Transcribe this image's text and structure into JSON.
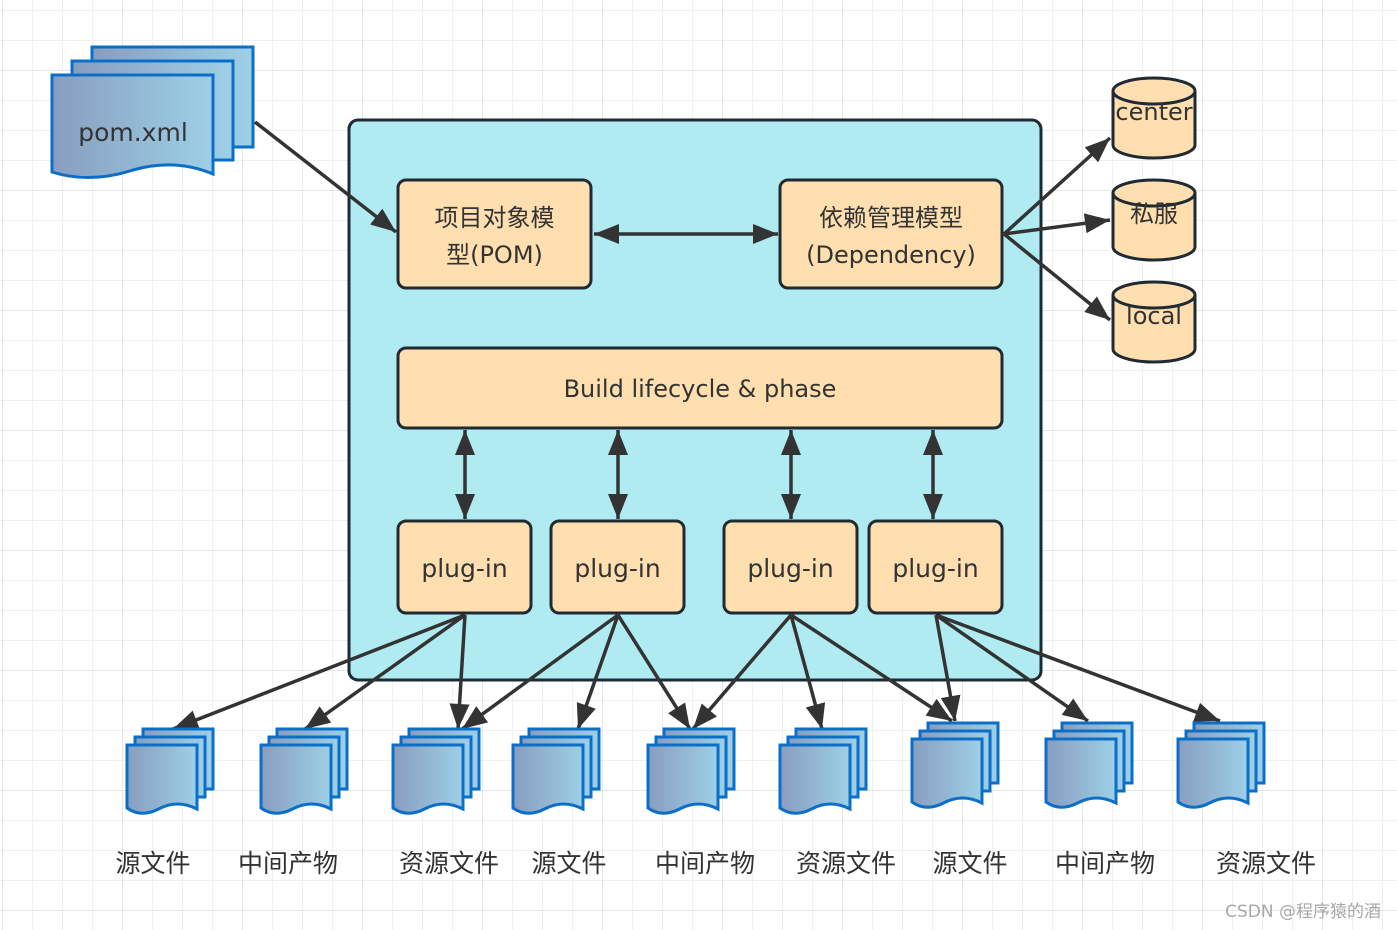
{
  "diagram": {
    "source": {
      "label": "pom.xml",
      "icon": "document-stack-icon"
    },
    "container": {
      "pom_model": {
        "line1": "项目对象模",
        "line2": "型(POM)"
      },
      "dependency_model": {
        "line1": "依赖管理模型",
        "line2": "(Dependency)"
      },
      "lifecycle": {
        "label": "Build lifecycle & phase"
      },
      "plugins": [
        {
          "label": "plug-in"
        },
        {
          "label": "plug-in"
        },
        {
          "label": "plug-in"
        },
        {
          "label": "plug-in"
        }
      ]
    },
    "repositories": [
      {
        "label": "center",
        "icon": "database-icon"
      },
      {
        "label": "私服",
        "icon": "database-icon"
      },
      {
        "label": "local",
        "icon": "database-icon"
      }
    ],
    "outputs": [
      {
        "label": "源文件"
      },
      {
        "label": "中间产物"
      },
      {
        "label": "资源文件"
      },
      {
        "label": "源文件"
      },
      {
        "label": "中间产物"
      },
      {
        "label": "资源文件"
      },
      {
        "label": "源文件"
      },
      {
        "label": "中间产物"
      },
      {
        "label": "资源文件"
      }
    ],
    "edges": [
      {
        "from": "pom.xml",
        "to": "项目对象模型(POM)"
      },
      {
        "from": "项目对象模型(POM)",
        "to": "依赖管理模型(Dependency)",
        "bidirectional": true
      },
      {
        "from": "依赖管理模型(Dependency)",
        "to": "center"
      },
      {
        "from": "依赖管理模型(Dependency)",
        "to": "私服"
      },
      {
        "from": "依赖管理模型(Dependency)",
        "to": "local"
      },
      {
        "from": "Build lifecycle & phase",
        "to": "plug-in 1",
        "bidirectional": true
      },
      {
        "from": "Build lifecycle & phase",
        "to": "plug-in 2",
        "bidirectional": true
      },
      {
        "from": "Build lifecycle & phase",
        "to": "plug-in 3",
        "bidirectional": true
      },
      {
        "from": "Build lifecycle & phase",
        "to": "plug-in 4",
        "bidirectional": true
      },
      {
        "from": "plug-in 1",
        "to": "output 1"
      },
      {
        "from": "plug-in 1",
        "to": "output 2"
      },
      {
        "from": "plug-in 1",
        "to": "output 3"
      },
      {
        "from": "plug-in 2",
        "to": "output 3"
      },
      {
        "from": "plug-in 2",
        "to": "output 4"
      },
      {
        "from": "plug-in 2",
        "to": "output 5"
      },
      {
        "from": "plug-in 3",
        "to": "output 5"
      },
      {
        "from": "plug-in 3",
        "to": "output 6"
      },
      {
        "from": "plug-in 3",
        "to": "output 7"
      },
      {
        "from": "plug-in 4",
        "to": "output 7"
      },
      {
        "from": "plug-in 4",
        "to": "output 8"
      },
      {
        "from": "plug-in 4",
        "to": "output 9"
      }
    ]
  },
  "colors": {
    "container_fill": "#b0ebf2",
    "node_fill": "#ffdfb0",
    "stroke": "#1f2a33",
    "arrow": "#333333",
    "doc_stroke": "#0b6fc9",
    "doc_gradient_start": "#8aa0c0",
    "doc_gradient_end": "#9ccfe6"
  },
  "watermark": "CSDN @程序猿的酒"
}
